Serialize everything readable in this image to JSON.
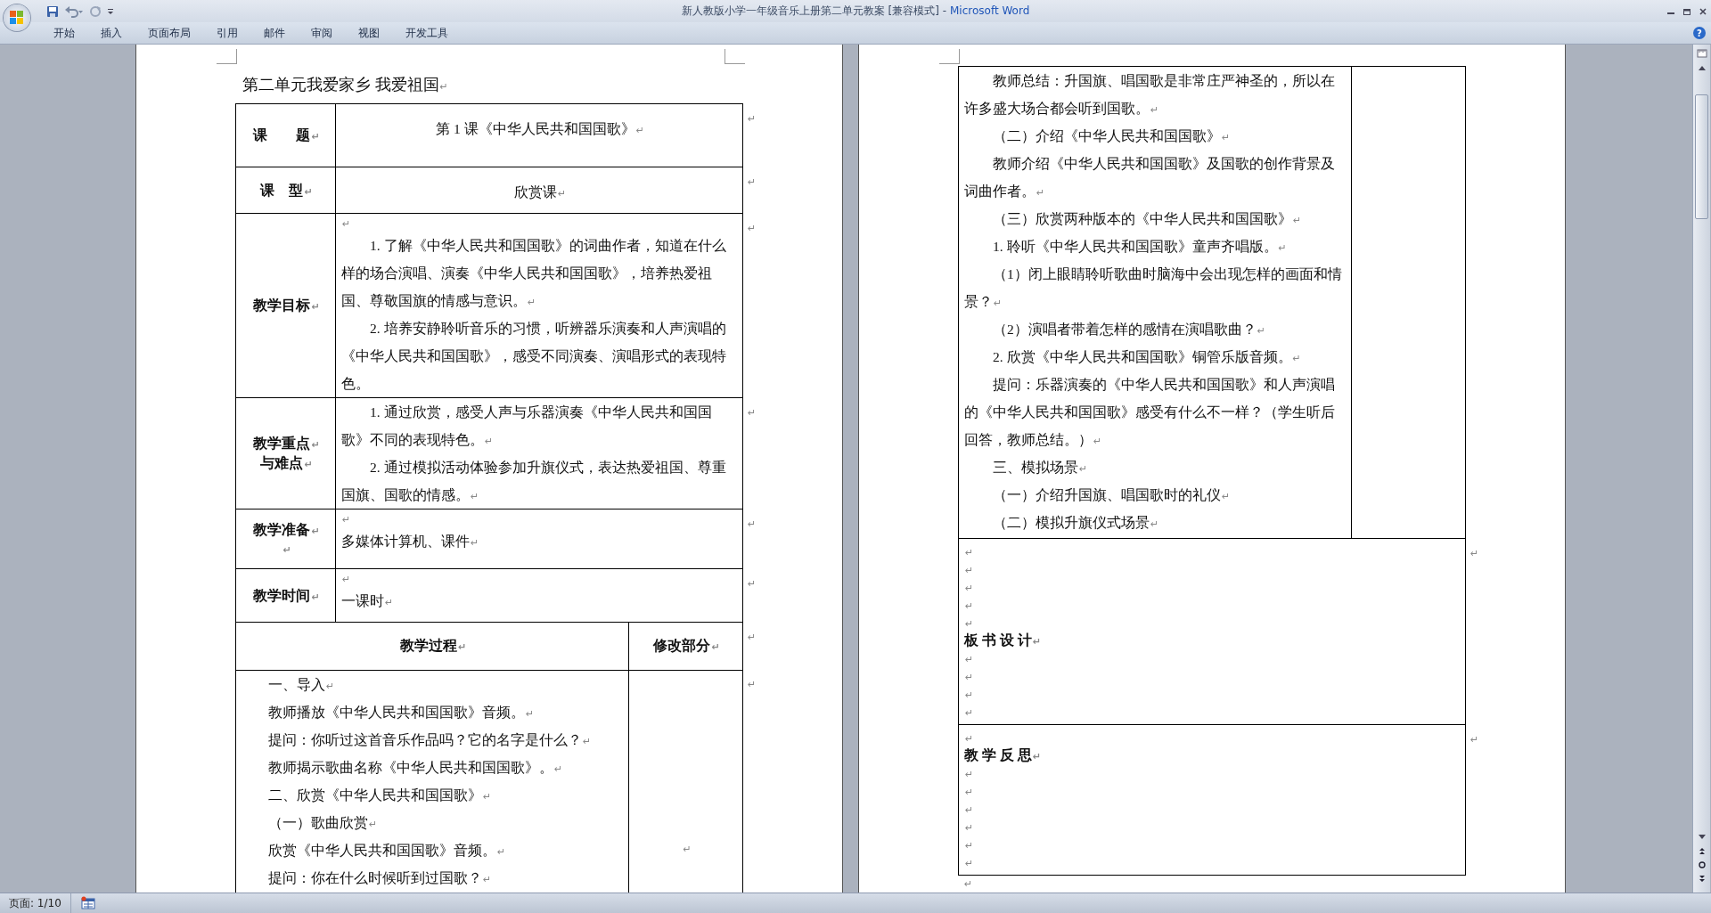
{
  "window": {
    "title": "新人教版小学一年级音乐上册第二单元教案 [兼容模式] -",
    "app": "Microsoft Word"
  },
  "ribbon_tabs": [
    {
      "label": "开始",
      "selected": false
    },
    {
      "label": "插入",
      "selected": false
    },
    {
      "label": "页面布局",
      "selected": false
    },
    {
      "label": "引用",
      "selected": false
    },
    {
      "label": "邮件",
      "selected": false
    },
    {
      "label": "审阅",
      "selected": false
    },
    {
      "label": "视图",
      "selected": false
    },
    {
      "label": "开发工具",
      "selected": false
    }
  ],
  "help": "?",
  "left_page": {
    "heading": {
      "text": "第二单元我爱家乡 我爱祖国",
      "mark": "↵"
    },
    "info_rows": [
      {
        "label": [
          {
            "text": "课　　题",
            "mark": "↵"
          }
        ],
        "content": [
          {
            "text": "第 1 课《中华人民共和国国歌》",
            "mark": "↵"
          }
        ],
        "kind": "centered",
        "row_mark": "↵"
      },
      {
        "label": [
          {
            "text": "课　型",
            "mark": "↵"
          }
        ],
        "content": [
          {
            "text": "欣赏课",
            "mark": "↵"
          }
        ],
        "kind": "centered",
        "row_mark": "↵"
      },
      {
        "label": [
          {
            "text": "教学目标",
            "mark": "↵"
          }
        ],
        "content": [
          {
            "mark": "↵"
          },
          {
            "text": "　　1. 了解《中华人民共和国国歌》的词曲作者，知道在什么样的场合演唱、演奏《中华人民共和国国歌》，培养热爱祖国、尊敬国旗的情感与意识。",
            "mark": "↵"
          },
          {
            "text": "　　2. 培养安静聆听音乐的习惯，听辨器乐演奏和人声演唱的《中华人民共和国国歌》，感受不同演奏、演唱形式的表现特色。"
          }
        ],
        "kind": "text",
        "row_mark": "↵"
      },
      {
        "label": [
          {
            "text": "教学重点",
            "mark": "↵"
          },
          {
            "text": "与难点",
            "mark": "↵"
          }
        ],
        "content": [
          {
            "text": "　　1. 通过欣赏，感受人声与乐器演奏《中华人民共和国国歌》不同的表现特色。",
            "mark": "↵"
          },
          {
            "text": "　　2. 通过模拟活动体验参加升旗仪式，表达热爱祖国、尊重国旗、国歌的情感。",
            "mark": "↵"
          }
        ],
        "kind": "text",
        "row_mark": "↵"
      },
      {
        "label": [
          {
            "text": "教学准备",
            "mark": "↵"
          },
          {
            "mark": "↵"
          }
        ],
        "content": [
          {
            "mark": "↵"
          },
          {
            "text": "多媒体计算机、课件",
            "mark": "↵"
          }
        ],
        "kind": "text",
        "row_mark": "↵"
      },
      {
        "label": [
          {
            "text": "教学时间",
            "mark": "↵"
          }
        ],
        "content": [
          {
            "mark": "↵"
          },
          {
            "text": "一课时",
            "mark": "↵"
          }
        ],
        "kind": "text",
        "row_mark": "↵"
      }
    ],
    "process": {
      "headers": [
        {
          "text": "教学过程",
          "mark": "↵"
        },
        {
          "text": "修改部分",
          "mark": "↵"
        }
      ],
      "header_row_mark": "↵",
      "body": [
        {
          "text": "一、导入",
          "mark": "↵"
        },
        {
          "text": "教师播放《中华人民共和国国歌》音频。",
          "mark": "↵"
        },
        {
          "text": "提问：你听过这首音乐作品吗？它的名字是什么？",
          "mark": "↵"
        },
        {
          "text": "教师揭示歌曲名称《中华人民共和国国歌》。",
          "mark": "↵"
        },
        {
          "text": "二、欣赏《中华人民共和国国歌》",
          "mark": "↵"
        },
        {
          "text": "（一）歌曲欣赏",
          "mark": "↵"
        },
        {
          "text": "欣赏《中华人民共和国国歌》音频。",
          "mark": "↵"
        },
        {
          "text": "提问：你在什么时候听到过国歌？",
          "mark": "↵"
        }
      ],
      "notes": [
        {
          "mark": "↵"
        }
      ],
      "row_mark": "↵"
    }
  },
  "right_page": {
    "process_body": [
      {
        "text": "　　教师总结：升国旗、唱国歌是非常庄严神圣的，所以在许多盛大场合都会听到国歌。",
        "mark": "↵"
      },
      {
        "text": "　　（二）介绍《中华人民共和国国歌》",
        "mark": "↵"
      },
      {
        "text": "　　教师介绍《中华人民共和国国歌》及国歌的创作背景及词曲作者。",
        "mark": "↵"
      },
      {
        "text": "　　（三）欣赏两种版本的《中华人民共和国国歌》",
        "mark": "↵"
      },
      {
        "text": "　　1. 聆听《中华人民共和国国歌》童声齐唱版。",
        "mark": "↵"
      },
      {
        "text": "　　（1）闭上眼睛聆听歌曲时脑海中会出现怎样的画面和情景？",
        "mark": "↵"
      },
      {
        "text": "　　（2）演唱者带着怎样的感情在演唱歌曲？",
        "mark": "↵"
      },
      {
        "text": "　　2. 欣赏《中华人民共和国国歌》铜管乐版音频。",
        "mark": "↵"
      },
      {
        "text": "　　提问：乐器演奏的《中华人民共和国国歌》和人声演唱的《中华人民共和国国歌》感受有什么不一样？（学生听后回答，教师总结。）",
        "mark": "↵"
      },
      {
        "text": "　　三、模拟场景",
        "mark": "↵"
      },
      {
        "text": "　　（一）介绍升国旗、唱国歌时的礼仪",
        "mark": "↵"
      },
      {
        "text": "　　（二）模拟升旗仪式场景",
        "mark": "↵"
      }
    ],
    "board": {
      "lines": [
        {
          "mark": "↵"
        },
        {
          "mark": "↵"
        },
        {
          "mark": "↵"
        },
        {
          "mark": "↵"
        },
        {
          "mark": "↵"
        },
        {
          "text": "板 书 设 计",
          "mark": "↵"
        },
        {
          "mark": "↵"
        },
        {
          "mark": "↵"
        },
        {
          "mark": "↵"
        },
        {
          "mark": "↵"
        }
      ],
      "row_mark": "↵"
    },
    "reflection": {
      "lines": [
        {
          "mark": "↵"
        },
        {
          "text": "教 学 反 思",
          "mark": "↵"
        },
        {
          "mark": "↵"
        },
        {
          "mark": "↵"
        },
        {
          "mark": "↵"
        },
        {
          "mark": "↵"
        },
        {
          "mark": "↵"
        },
        {
          "mark": "↵"
        }
      ],
      "row_mark": "↵"
    },
    "end_mark": "↵"
  },
  "status_bar": {
    "page": "页面: 1/10"
  }
}
